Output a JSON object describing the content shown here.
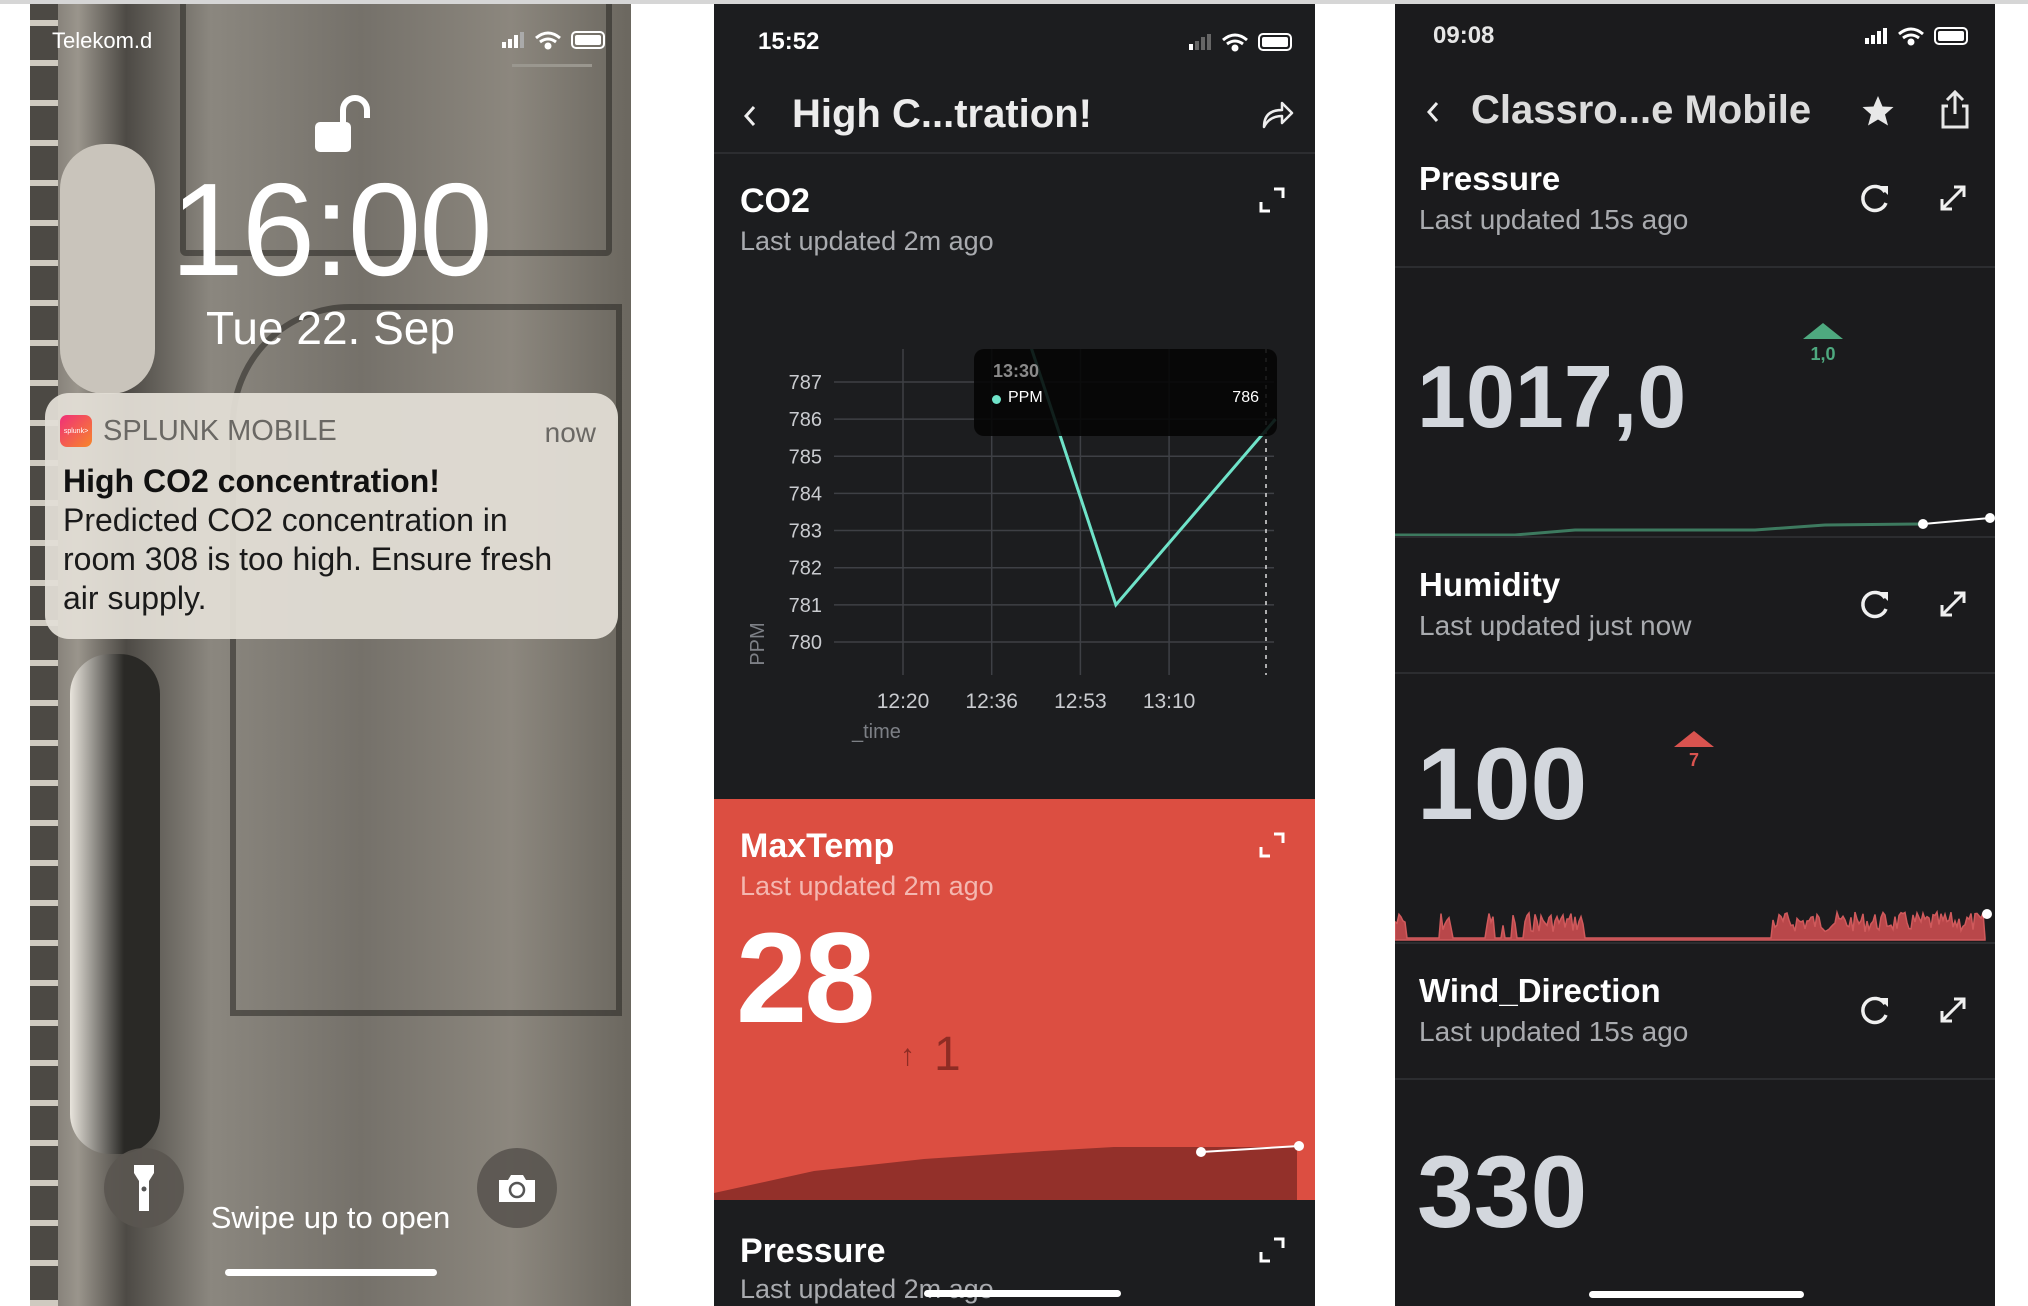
{
  "lock_screen": {
    "carrier": "Telekom.d",
    "time": "16:00",
    "date": "Tue 22. Sep",
    "notification": {
      "app_name": "SPLUNK MOBILE",
      "app_logo_text": "splunk>",
      "timestamp": "now",
      "title": "High CO2 concentration!",
      "body_lines": [
        "Predicted CO2 concentration in",
        "room 308 is too high. Ensure fresh",
        "air supply."
      ]
    },
    "hint": "Swipe up to open",
    "icons": {
      "lock": "unlocked-padlock-icon",
      "flashlight": "flashlight-icon",
      "camera": "camera-icon"
    }
  },
  "alert_screen": {
    "status_time": "15:52",
    "title": "High C...tration!",
    "panels": [
      {
        "title": "CO2",
        "updated": "Last updated 2m ago"
      },
      {
        "title": "MaxTemp",
        "updated": "Last updated 2m ago",
        "value": "28",
        "delta_arrow": "↑",
        "delta": "1"
      },
      {
        "title": "Pressure",
        "updated": "Last updated 2m ago"
      }
    ],
    "tooltip": {
      "time": "13:30",
      "series": "PPM",
      "value": "786"
    },
    "colors": {
      "line": "#6fe3c9",
      "alert": "#dc4e41",
      "alert_dark": "#93302a",
      "background": "#1c1d1f"
    }
  },
  "chart_data": {
    "type": "line",
    "title": "",
    "xlabel": "_time",
    "ylabel": "PPM",
    "x_ticks": [
      "12:20",
      "12:36",
      "12:53",
      "13:10"
    ],
    "y_ticks": [
      787,
      786,
      785,
      784,
      783,
      782,
      781,
      780
    ],
    "ylim": [
      779.3,
      788
    ],
    "grid": true,
    "series": [
      {
        "name": "PPM",
        "x": [
          "12:40",
          "13:00",
          "13:30"
        ],
        "values": [
          789.7,
          781,
          786
        ]
      }
    ]
  },
  "dashboard_screen": {
    "status_time": "09:08",
    "title": "Classro...e Mobile",
    "panels": [
      {
        "title": "Pressure",
        "updated": "Last updated 15s ago",
        "value": "1017,0",
        "delta": "1,0",
        "trend": "up",
        "trend_color": "#4ea97f"
      },
      {
        "title": "Humidity",
        "updated": "Last updated just now",
        "value": "100",
        "delta": "7",
        "trend": "up",
        "trend_color": "#d9534f"
      },
      {
        "title": "Wind_Direction",
        "updated": "Last updated 15s ago",
        "value": "330"
      }
    ]
  }
}
